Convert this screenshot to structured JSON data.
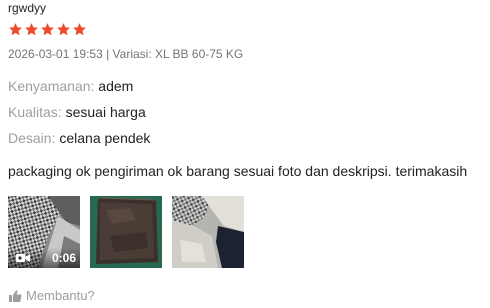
{
  "review": {
    "username": "rgwdyy",
    "rating": 5,
    "rating_max": 5,
    "star_color": "#ee4d2d",
    "meta": "2026-03-01 19:53 | Variasi: XL BB 60-75 KG",
    "attributes": [
      {
        "label": "Kenyamanan:",
        "value": "adem"
      },
      {
        "label": "Kualitas:",
        "value": "sesuai harga"
      },
      {
        "label": "Desain:",
        "value": "celana pendek"
      }
    ],
    "comment": "packaging ok pengiriman ok barang sesuai foto dan deskripsi. terimakasih",
    "media": [
      {
        "type": "video",
        "duration": "0:06",
        "icon": "video-camera-icon"
      },
      {
        "type": "photo"
      },
      {
        "type": "photo"
      }
    ],
    "helpful_label": "Membantu?",
    "helpful_icon": "thumbs-up-icon"
  }
}
